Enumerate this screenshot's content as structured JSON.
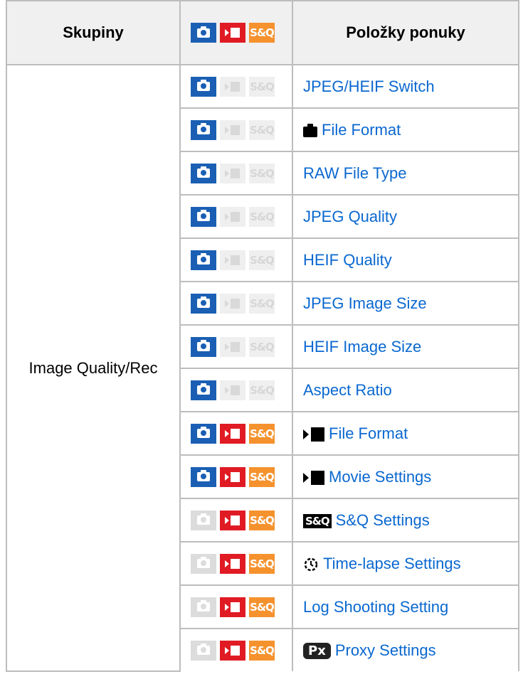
{
  "header": {
    "col_groups": "Skupiny",
    "col_items": "Položky ponuky"
  },
  "header_modes": {
    "photo": true,
    "movie": true,
    "sq": true
  },
  "mode_labels": {
    "sq": "S&Q"
  },
  "group_name": "Image Quality/Rec",
  "colors": {
    "photo": "#1a5fb4",
    "movie": "#e01b24",
    "sq": "#f5922e",
    "link": "#0a68d0",
    "header_bg": "#f0f0f0"
  },
  "rows": [
    {
      "label": "JPEG/HEIF Switch",
      "prefix_icon": "",
      "modes": {
        "photo": true,
        "movie": false,
        "sq": false
      }
    },
    {
      "label": "File Format",
      "prefix_icon": "camera-icon",
      "modes": {
        "photo": true,
        "movie": false,
        "sq": false
      }
    },
    {
      "label": "RAW File Type",
      "prefix_icon": "",
      "modes": {
        "photo": true,
        "movie": false,
        "sq": false
      }
    },
    {
      "label": "JPEG Quality",
      "prefix_icon": "",
      "modes": {
        "photo": true,
        "movie": false,
        "sq": false
      }
    },
    {
      "label": "HEIF Quality",
      "prefix_icon": "",
      "modes": {
        "photo": true,
        "movie": false,
        "sq": false
      }
    },
    {
      "label": "JPEG Image Size",
      "prefix_icon": "",
      "modes": {
        "photo": true,
        "movie": false,
        "sq": false
      }
    },
    {
      "label": "HEIF Image Size",
      "prefix_icon": "",
      "modes": {
        "photo": true,
        "movie": false,
        "sq": false
      }
    },
    {
      "label": "Aspect Ratio",
      "prefix_icon": "",
      "modes": {
        "photo": true,
        "movie": false,
        "sq": false
      }
    },
    {
      "label": "File Format",
      "prefix_icon": "movie-icon",
      "modes": {
        "photo": true,
        "movie": true,
        "sq": true
      }
    },
    {
      "label": "Movie Settings",
      "prefix_icon": "movie-icon",
      "modes": {
        "photo": true,
        "movie": true,
        "sq": true
      }
    },
    {
      "label": "S&Q Settings",
      "prefix_icon": "sq-icon",
      "prefix_text": "S&Q",
      "modes": {
        "photo": false,
        "movie": true,
        "sq": true
      }
    },
    {
      "label": "Time-lapse Settings",
      "prefix_icon": "timelapse-icon",
      "modes": {
        "photo": false,
        "movie": true,
        "sq": true
      }
    },
    {
      "label": "Log Shooting Setting",
      "prefix_icon": "",
      "modes": {
        "photo": false,
        "movie": true,
        "sq": true
      }
    },
    {
      "label": "Proxy Settings",
      "prefix_icon": "proxy-icon",
      "prefix_text": "Px",
      "modes": {
        "photo": false,
        "movie": true,
        "sq": true
      }
    }
  ]
}
